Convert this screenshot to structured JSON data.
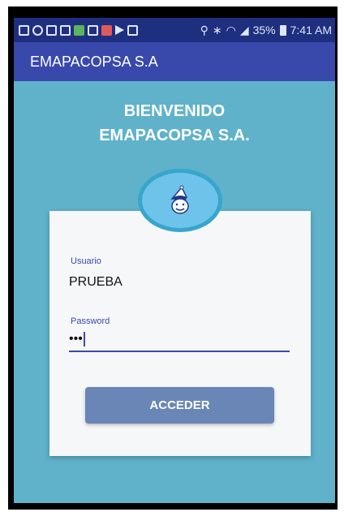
{
  "status_bar": {
    "icons": [
      "facebook-icon",
      "blocked-icon",
      "message-icon",
      "mail-icon",
      "gmail-icon",
      "image-icon",
      "email-icon",
      "play-store-icon",
      "facebook-icon"
    ],
    "right_icons": [
      "location-icon",
      "bluetooth-icon",
      "wifi-icon",
      "signal-icon"
    ],
    "battery": "35%",
    "time": "7:41 AM"
  },
  "app_bar": {
    "title": "EMAPACOPSA S.A"
  },
  "welcome": {
    "line1": "BIENVENIDO",
    "line2": "EMAPACOPSA S.A."
  },
  "logo": {
    "icon": "mascot-icon"
  },
  "form": {
    "usuario_label": "Usuario",
    "usuario_value": "PRUEBA",
    "password_label": "Password",
    "password_value": "•••",
    "submit_label": "ACCEDER"
  },
  "colors": {
    "status_bar": "#1f2f80",
    "app_bar": "#3949ab",
    "background": "#5fb2c9",
    "card": "#f6f7f9",
    "accent": "#3949ab",
    "button": "#6a86b6",
    "logo_fill": "#6ec3ea",
    "logo_border": "#36a6cc"
  }
}
